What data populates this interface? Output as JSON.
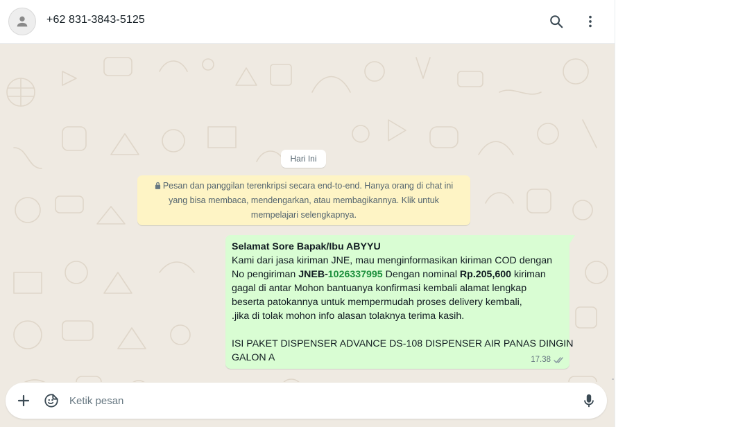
{
  "header": {
    "contact_name": "+62 831-3843-5125",
    "avatar_icon": "person-icon",
    "search_icon": "search-icon",
    "menu_icon": "kebab-menu-icon"
  },
  "chat": {
    "day_label": "Hari Ini",
    "encryption_notice": {
      "icon": "lock-icon",
      "lines": [
        "Pesan dan panggilan terenkripsi secara end-to-end. Hanya orang di chat ini",
        "yang bisa membaca, mendengarkan, atau membagikannya. Klik untuk",
        "mempelajari selengkapnya."
      ]
    },
    "message": {
      "greeting": "Selamat Sore Bapak/Ibu ABYYU",
      "line1": "Kami dari jasa kiriman JNE, mau menginformasikan kiriman COD dengan",
      "line2_a": "No pengiriman ",
      "line2_prefix": "JNEB-",
      "line2_number": "1026337995",
      "line2_b": " Dengan nominal ",
      "line2_amount": "Rp.205,600",
      "line2_c": " kiriman",
      "line3": "gagal di antar Mohon bantuanya konfirmasi kembali alamat lengkap",
      "line4": "beserta patokannya untuk mempermudah proses delivery kembali,",
      "line5": " .jika di tolak mohon info alasan tolaknya terima kasih.",
      "line6": "ISI PAKET DISPENSER ADVANCE DS-108 DISPENSER AIR PANAS DINGIN",
      "line7": "GALON A",
      "time": "17.38",
      "status_icon": "double-check-icon"
    }
  },
  "composer": {
    "attach_icon": "plus-icon",
    "sticker_icon": "sticker-icon",
    "placeholder": "Ketik pesan",
    "value": "",
    "mic_icon": "microphone-icon"
  },
  "colors": {
    "chat_background": "#efeae2",
    "outgoing_bubble": "#d9fdd3",
    "notice_background": "#fef4c5",
    "tracking_number": "#1c8f3c"
  }
}
